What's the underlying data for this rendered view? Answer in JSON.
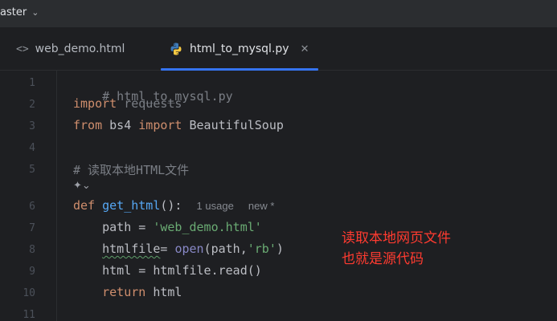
{
  "topbar": {
    "branch": "aster"
  },
  "tabs": [
    {
      "label": "web_demo.html",
      "icon": "html-icon",
      "active": false
    },
    {
      "label": "html_to_mysql.py",
      "icon": "python-icon",
      "active": true
    }
  ],
  "editor": {
    "line_numbers": [
      "1",
      "2",
      "3",
      "4",
      "5",
      "6",
      "7",
      "8",
      "9",
      "10",
      "11"
    ],
    "lines": {
      "l1": "# html_to_mysql.py",
      "l2_kw": "import",
      "l2_rest": " requests",
      "l3_kw1": "from",
      "l3_mod": " bs4 ",
      "l3_kw2": "import",
      "l3_rest": " BeautifulSoup",
      "l5": "# 读取本地HTML文件",
      "l6_kw": "def",
      "l6_fn": "get_html",
      "l6_rest": "():",
      "l6_usage": "1 usage",
      "l6_new": "new *",
      "l7_var": "path",
      "l7_eq": " = ",
      "l7_str": "'web_demo.html'",
      "l8_var": "htmlfile",
      "l8_eq": "= ",
      "l8_fn": "open",
      "l8_args": "(path,",
      "l8_str": "'rb'",
      "l8_close": ")",
      "l9": "html = htmlfile.read()",
      "l10_kw": "return",
      "l10_rest": " html"
    }
  },
  "annotation": {
    "line1": "读取本地网页文件",
    "line2": "也就是源代码"
  }
}
